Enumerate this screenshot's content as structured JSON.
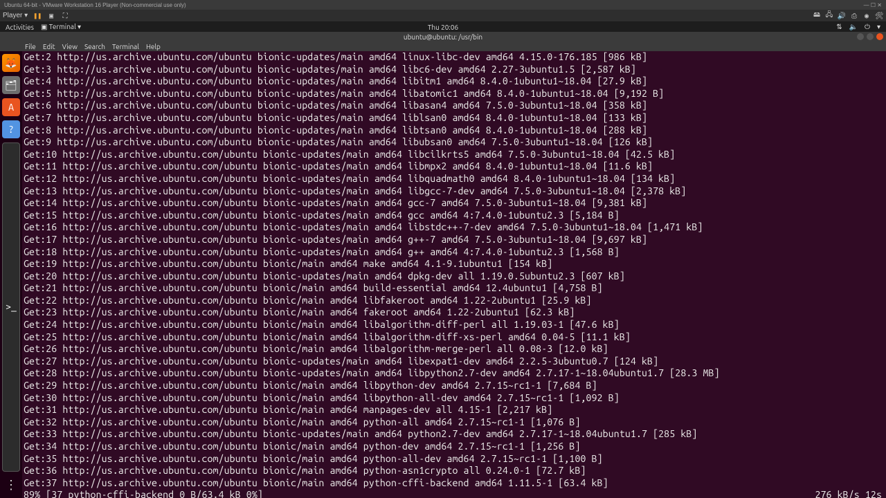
{
  "vmware": {
    "title": "Ubuntu 64-bit - VMware Workstation 16 Player (Non-commercial use only)",
    "player_label": "Player ▾"
  },
  "gnome": {
    "activities": "Activities",
    "app": "Terminal ▾",
    "clock": "Thu 20:06"
  },
  "window": {
    "title": "ubuntu@ubuntu: /usr/bin"
  },
  "menubar": [
    "File",
    "Edit",
    "View",
    "Search",
    "Terminal",
    "Help"
  ],
  "lines": [
    "Get:2 http://us.archive.ubuntu.com/ubuntu bionic-updates/main amd64 linux-libc-dev amd64 4.15.0-176.185 [986 kB]",
    "Get:3 http://us.archive.ubuntu.com/ubuntu bionic-updates/main amd64 libc6-dev amd64 2.27-3ubuntu1.5 [2,587 kB]",
    "Get:4 http://us.archive.ubuntu.com/ubuntu bionic-updates/main amd64 libitm1 amd64 8.4.0-1ubuntu1~18.04 [27.9 kB]",
    "Get:5 http://us.archive.ubuntu.com/ubuntu bionic-updates/main amd64 libatomic1 amd64 8.4.0-1ubuntu1~18.04 [9,192 B]",
    "Get:6 http://us.archive.ubuntu.com/ubuntu bionic-updates/main amd64 libasan4 amd64 7.5.0-3ubuntu1~18.04 [358 kB]",
    "Get:7 http://us.archive.ubuntu.com/ubuntu bionic-updates/main amd64 liblsan0 amd64 8.4.0-1ubuntu1~18.04 [133 kB]",
    "Get:8 http://us.archive.ubuntu.com/ubuntu bionic-updates/main amd64 libtsan0 amd64 8.4.0-1ubuntu1~18.04 [288 kB]",
    "Get:9 http://us.archive.ubuntu.com/ubuntu bionic-updates/main amd64 libubsan0 amd64 7.5.0-3ubuntu1~18.04 [126 kB]",
    "Get:10 http://us.archive.ubuntu.com/ubuntu bionic-updates/main amd64 libcilkrts5 amd64 7.5.0-3ubuntu1~18.04 [42.5 kB]",
    "Get:11 http://us.archive.ubuntu.com/ubuntu bionic-updates/main amd64 libmpx2 amd64 8.4.0-1ubuntu1~18.04 [11.6 kB]",
    "Get:12 http://us.archive.ubuntu.com/ubuntu bionic-updates/main amd64 libquadmath0 amd64 8.4.0-1ubuntu1~18.04 [134 kB]",
    "Get:13 http://us.archive.ubuntu.com/ubuntu bionic-updates/main amd64 libgcc-7-dev amd64 7.5.0-3ubuntu1~18.04 [2,378 kB]",
    "Get:14 http://us.archive.ubuntu.com/ubuntu bionic-updates/main amd64 gcc-7 amd64 7.5.0-3ubuntu1~18.04 [9,381 kB]",
    "Get:15 http://us.archive.ubuntu.com/ubuntu bionic-updates/main amd64 gcc amd64 4:7.4.0-1ubuntu2.3 [5,184 B]",
    "Get:16 http://us.archive.ubuntu.com/ubuntu bionic-updates/main amd64 libstdc++-7-dev amd64 7.5.0-3ubuntu1~18.04 [1,471 kB]",
    "Get:17 http://us.archive.ubuntu.com/ubuntu bionic-updates/main amd64 g++-7 amd64 7.5.0-3ubuntu1~18.04 [9,697 kB]",
    "Get:18 http://us.archive.ubuntu.com/ubuntu bionic-updates/main amd64 g++ amd64 4:7.4.0-1ubuntu2.3 [1,568 B]",
    "Get:19 http://us.archive.ubuntu.com/ubuntu bionic/main amd64 make amd64 4.1-9.1ubuntu1 [154 kB]",
    "Get:20 http://us.archive.ubuntu.com/ubuntu bionic-updates/main amd64 dpkg-dev all 1.19.0.5ubuntu2.3 [607 kB]",
    "Get:21 http://us.archive.ubuntu.com/ubuntu bionic/main amd64 build-essential amd64 12.4ubuntu1 [4,758 B]",
    "Get:22 http://us.archive.ubuntu.com/ubuntu bionic/main amd64 libfakeroot amd64 1.22-2ubuntu1 [25.9 kB]",
    "Get:23 http://us.archive.ubuntu.com/ubuntu bionic/main amd64 fakeroot amd64 1.22-2ubuntu1 [62.3 kB]",
    "Get:24 http://us.archive.ubuntu.com/ubuntu bionic/main amd64 libalgorithm-diff-perl all 1.19.03-1 [47.6 kB]",
    "Get:25 http://us.archive.ubuntu.com/ubuntu bionic/main amd64 libalgorithm-diff-xs-perl amd64 0.04-5 [11.1 kB]",
    "Get:26 http://us.archive.ubuntu.com/ubuntu bionic/main amd64 libalgorithm-merge-perl all 0.08-3 [12.0 kB]",
    "Get:27 http://us.archive.ubuntu.com/ubuntu bionic-updates/main amd64 libexpat1-dev amd64 2.2.5-3ubuntu0.7 [124 kB]",
    "Get:28 http://us.archive.ubuntu.com/ubuntu bionic-updates/main amd64 libpython2.7-dev amd64 2.7.17-1~18.04ubuntu1.7 [28.3 MB]",
    "Get:29 http://us.archive.ubuntu.com/ubuntu bionic/main amd64 libpython-dev amd64 2.7.15~rc1-1 [7,684 B]",
    "Get:30 http://us.archive.ubuntu.com/ubuntu bionic/main amd64 libpython-all-dev amd64 2.7.15~rc1-1 [1,092 B]",
    "Get:31 http://us.archive.ubuntu.com/ubuntu bionic/main amd64 manpages-dev all 4.15-1 [2,217 kB]",
    "Get:32 http://us.archive.ubuntu.com/ubuntu bionic/main amd64 python-all amd64 2.7.15~rc1-1 [1,076 B]",
    "Get:33 http://us.archive.ubuntu.com/ubuntu bionic-updates/main amd64 python2.7-dev amd64 2.7.17-1~18.04ubuntu1.7 [285 kB]",
    "Get:34 http://us.archive.ubuntu.com/ubuntu bionic/main amd64 python-dev amd64 2.7.15~rc1-1 [1,256 B]",
    "Get:35 http://us.archive.ubuntu.com/ubuntu bionic/main amd64 python-all-dev amd64 2.7.15~rc1-1 [1,100 B]",
    "Get:36 http://us.archive.ubuntu.com/ubuntu bionic/main amd64 python-asn1crypto all 0.24.0-1 [72.7 kB]",
    "Get:37 http://us.archive.ubuntu.com/ubuntu bionic/main amd64 python-cffi-backend amd64 1.11.5-1 [63.4 kB]"
  ],
  "status": {
    "left": "89% [37 python-cffi-backend 0 B/63.4 kB 0%]",
    "right": "276 kB/s 12s"
  }
}
